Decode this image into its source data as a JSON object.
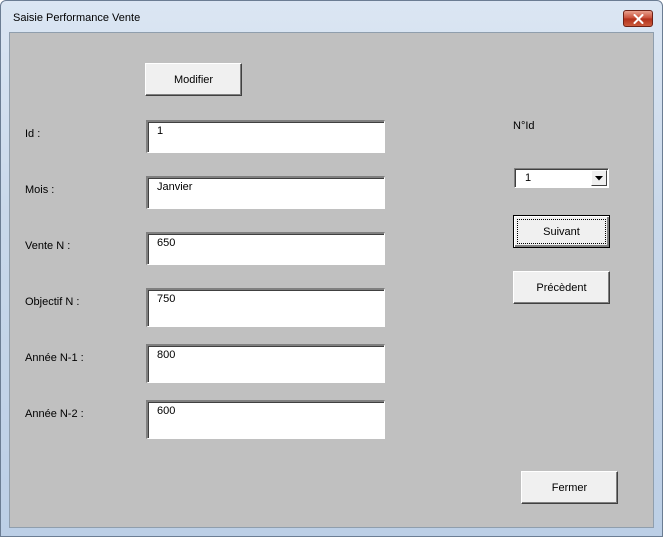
{
  "window": {
    "title": "Saisie Performance Vente"
  },
  "buttons": {
    "modifier": "Modifier",
    "suivant": "Suivant",
    "precedent": "Précèdent",
    "fermer": "Fermer"
  },
  "fields": [
    {
      "label": "Id :",
      "value": "1"
    },
    {
      "label": "Mois :",
      "value": "Janvier"
    },
    {
      "label": "Vente N :",
      "value": "650"
    },
    {
      "label": "Objectif N :",
      "value": "750"
    },
    {
      "label": "Année N-1 :",
      "value": "800"
    },
    {
      "label": "Année N-2 :",
      "value": "600"
    }
  ],
  "nid": {
    "label": "N°Id",
    "selected": "1"
  },
  "icons": {
    "close": "close-icon",
    "dropdown": "chevron-down-icon"
  }
}
